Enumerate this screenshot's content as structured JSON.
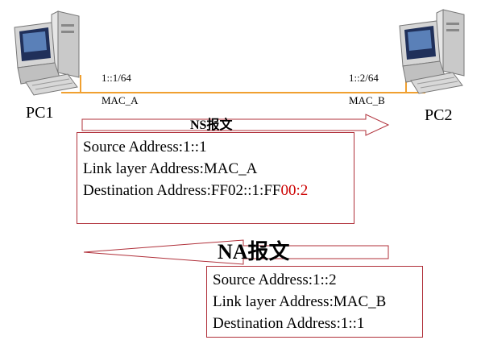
{
  "pc1": {
    "label": "PC1",
    "ip": "1::1/64",
    "mac": "MAC_A"
  },
  "pc2": {
    "label": "PC2",
    "ip": "1::2/64",
    "mac": "MAC_B"
  },
  "ns": {
    "title": "NS报文",
    "source": "Source Address:1::1",
    "link": "Link layer Address:MAC_A",
    "dest_prefix": "Destination Address:FF02::1:FF",
    "dest_suffix": "00:2"
  },
  "na": {
    "title": "NA报文",
    "source": "Source Address:1::2",
    "link": "Link layer Address:MAC_B",
    "dest": "Destination Address:1::1"
  },
  "colors": {
    "link": "#f0a030",
    "box_border": "#b0303a",
    "highlight": "#cc0000"
  }
}
